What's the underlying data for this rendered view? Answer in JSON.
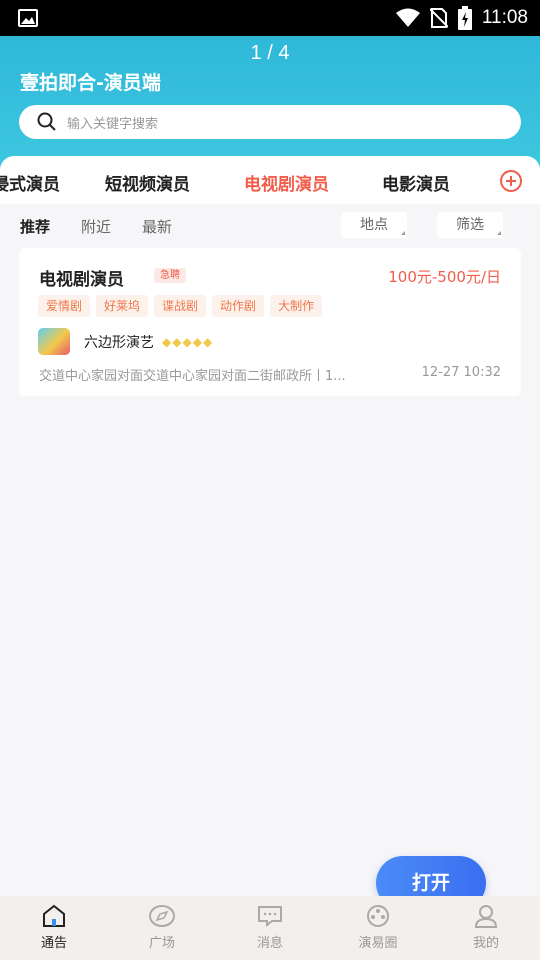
{
  "status_bar": {
    "time": "11:08",
    "icons": [
      "image-icon",
      "wifi-icon",
      "no-sim-icon",
      "battery-charging-icon"
    ]
  },
  "header": {
    "page_indicator": "1 / 4",
    "app_title": "壹拍即合-演员端",
    "search_placeholder": "输入关键字搜索",
    "background_color": "#3ec7e0"
  },
  "category_tabs": {
    "items": [
      "浸式演员",
      "短视频演员",
      "电视剧演员",
      "电影演员"
    ],
    "active_index": 2,
    "active_color": "#f25c4b",
    "add_icon": "plus-circle-icon"
  },
  "sub_tabs": {
    "items": [
      "推荐",
      "附近",
      "最新"
    ],
    "active_index": 0
  },
  "filters": {
    "location": "地点",
    "screen": "筛选"
  },
  "job_card": {
    "title": "电视剧演员",
    "urgent_badge": "急聘",
    "price": "100元-500元/日",
    "tags": [
      "爱情剧",
      "好莱坞",
      "谍战剧",
      "动作剧",
      "大制作"
    ],
    "company_name": "六边形演艺",
    "rating_gems": 5,
    "location": "交道中心家园对面交道中心家园对面二街邮政所丨1...",
    "date": "12-27 10:32"
  },
  "open_button": "打开",
  "bottom_nav": {
    "items": [
      {
        "label": "通告",
        "icon": "home-icon"
      },
      {
        "label": "广场",
        "icon": "compass-icon"
      },
      {
        "label": "消息",
        "icon": "message-icon"
      },
      {
        "label": "演易圈",
        "icon": "film-reel-icon"
      },
      {
        "label": "我的",
        "icon": "user-icon"
      }
    ],
    "active_index": 0
  }
}
